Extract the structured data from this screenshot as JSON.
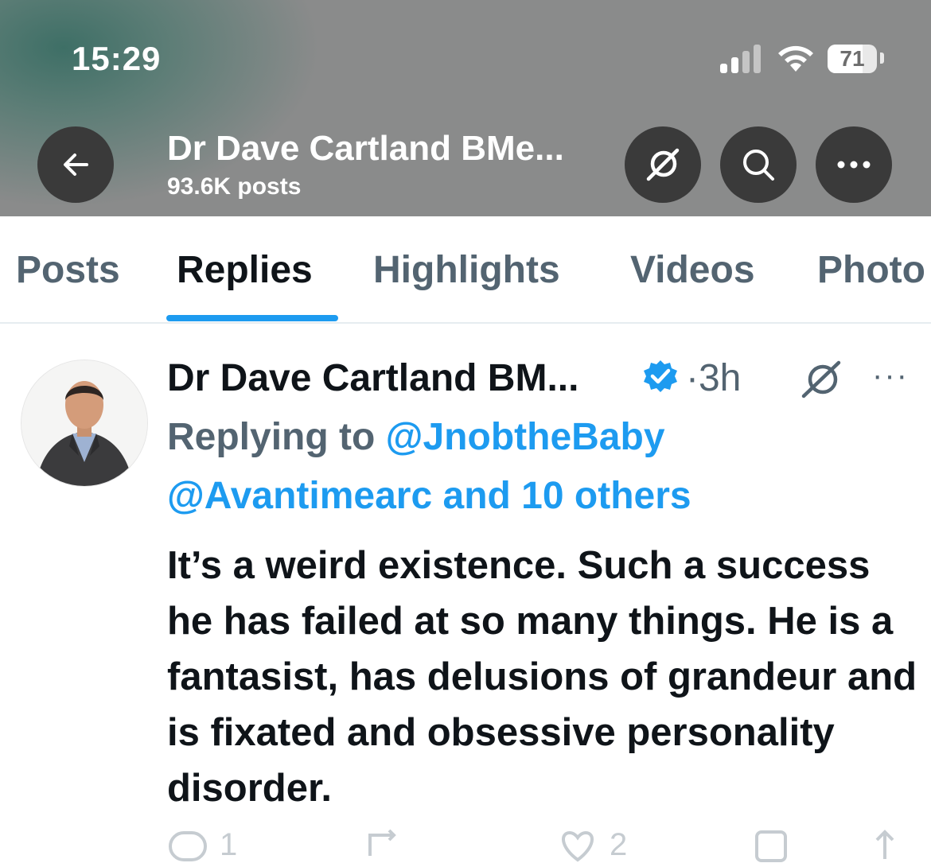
{
  "status_bar": {
    "time": "15:29",
    "battery_level": "71",
    "signal_icon": "signal-bars-icon",
    "wifi_icon": "wifi-icon"
  },
  "header": {
    "profile_name": "Dr Dave Cartland BMe...",
    "post_count": "93.6K posts",
    "back_icon": "arrow-left-icon",
    "grok_icon": "grok-icon",
    "search_icon": "search-icon",
    "more_icon": "more-horizontal-icon"
  },
  "tabs": [
    {
      "label": "Posts",
      "active": false
    },
    {
      "label": "Replies",
      "active": true
    },
    {
      "label": "Highlights",
      "active": false
    },
    {
      "label": "Videos",
      "active": false
    },
    {
      "label": "Photo",
      "active": false
    }
  ],
  "tweet": {
    "author": "Dr Dave Cartland BM...",
    "separator": "·",
    "time": "3h",
    "more": "···",
    "replying_prefix": "Replying to ",
    "replying_handle": "@JnobtheBaby",
    "replying_line2": "@Avantimearc and 10 others",
    "text": "It’s a weird existence. Such a success he has failed at so many things. He is a fantasist, has delusions of grandeur and is fixated and obsessive personality disorder.",
    "reply_count": "1",
    "like_count": "2"
  },
  "colors": {
    "accent": "#1d9bf0",
    "text_primary": "#0f1419",
    "text_secondary": "#536471",
    "header_bg": "#8a8b8b"
  }
}
